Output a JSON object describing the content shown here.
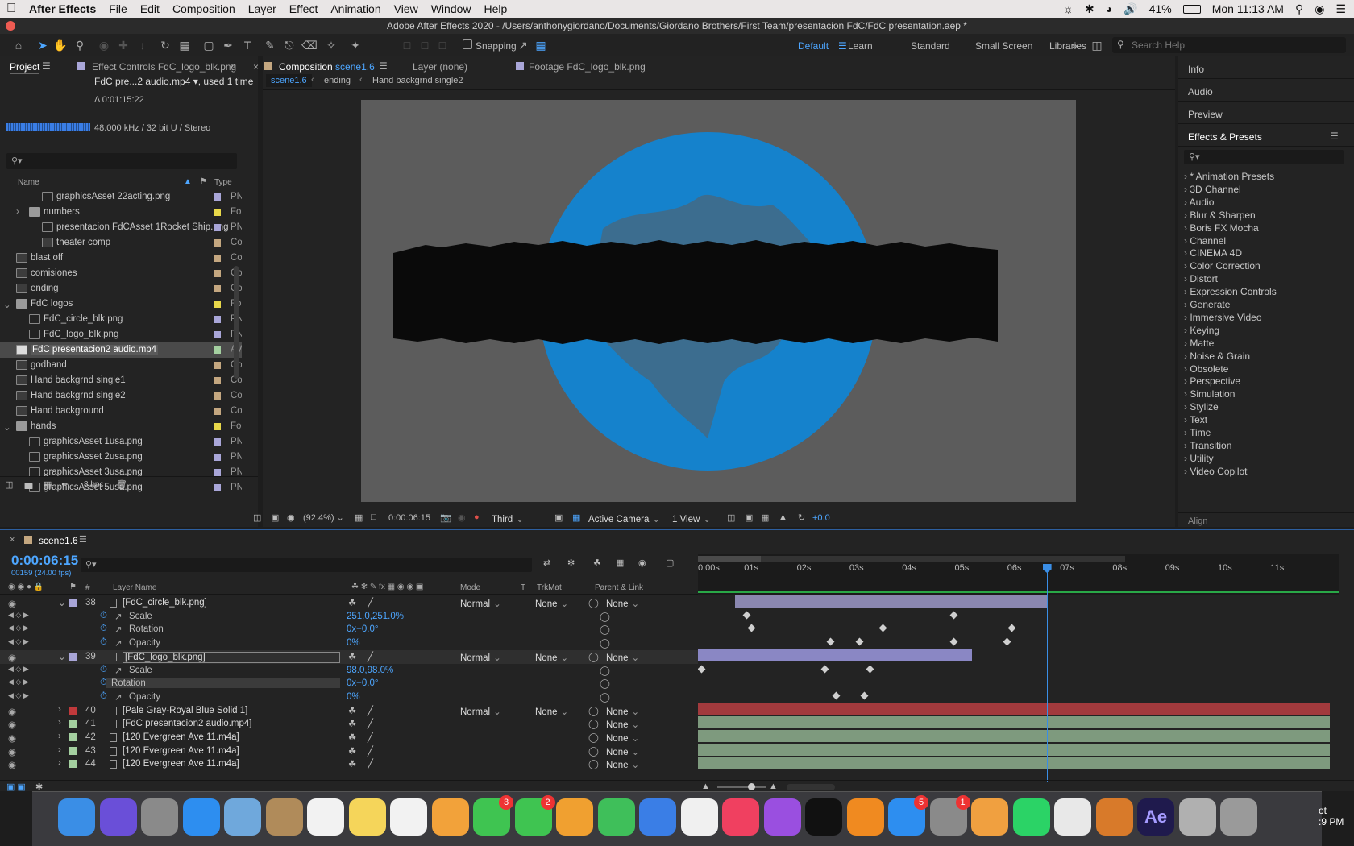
{
  "menubar": {
    "app_name": "After Effects",
    "items": [
      "File",
      "Edit",
      "Composition",
      "Layer",
      "Effect",
      "Animation",
      "View",
      "Window",
      "Help"
    ],
    "battery": "41%",
    "clock": "Mon 11:13 AM"
  },
  "window": {
    "title": "Adobe After Effects 2020 - /Users/anthonygiordano/Documents/Giordano Brothers/First Team/presentacion FdC/FdC presentation.aep *"
  },
  "toolbar": {
    "snapping_label": "Snapping",
    "workspaces": [
      "Default",
      "Learn",
      "Standard",
      "Small Screen",
      "Libraries"
    ],
    "active_workspace": "Default",
    "search_placeholder": "Search Help"
  },
  "project": {
    "tab_project": "Project",
    "tab_effect_controls": "Effect Controls FdC_logo_blk.png",
    "selected_item": "FdC pre...2 audio.mp4 ▾",
    "used_text": ", used 1 time",
    "duration": "Δ 0:01:15:22",
    "audio_info": "48.000 kHz / 32 bit U / Stereo",
    "search_placeholder": "",
    "col_name": "Name",
    "col_type": "Type",
    "items": [
      {
        "name": "graphicsAsset 22acting.png",
        "type": "PN",
        "icon": "png",
        "indent": 2,
        "label": "#a9a6d8"
      },
      {
        "name": "numbers",
        "type": "Fol",
        "icon": "folder",
        "indent": 1,
        "label": "#e8d84a",
        "arrow": "›"
      },
      {
        "name": "presentacion FdCAsset 1Rocket Ship.png",
        "type": "PN",
        "icon": "png",
        "indent": 2,
        "label": "#a9a6d8"
      },
      {
        "name": "theater comp",
        "type": "Cor",
        "icon": "comp",
        "indent": 2,
        "label": "#c4a780"
      },
      {
        "name": "blast off",
        "type": "Cor",
        "icon": "comp",
        "indent": 0,
        "label": "#c4a780"
      },
      {
        "name": "comisiones",
        "type": "Cor",
        "icon": "comp",
        "indent": 0,
        "label": "#c4a780"
      },
      {
        "name": "ending",
        "type": "Cor",
        "icon": "comp",
        "indent": 0,
        "label": "#c4a780"
      },
      {
        "name": "FdC logos",
        "type": "Fol",
        "icon": "folder",
        "indent": 0,
        "label": "#e8d84a",
        "arrow": "⌄"
      },
      {
        "name": "FdC_circle_blk.png",
        "type": "PN",
        "icon": "png",
        "indent": 1,
        "label": "#a9a6d8"
      },
      {
        "name": "FdC_logo_blk.png",
        "type": "PN",
        "icon": "png",
        "indent": 1,
        "label": "#a9a6d8"
      },
      {
        "name": "FdC presentacion2 audio.mp4",
        "type": "AVI",
        "icon": "av",
        "indent": 0,
        "label": "#a4d0a0",
        "selected": true
      },
      {
        "name": "godhand",
        "type": "Cor",
        "icon": "comp",
        "indent": 0,
        "label": "#c4a780"
      },
      {
        "name": "Hand backgrnd single1",
        "type": "Cor",
        "icon": "comp",
        "indent": 0,
        "label": "#c4a780"
      },
      {
        "name": "Hand backgrnd single2",
        "type": "Cor",
        "icon": "comp",
        "indent": 0,
        "label": "#c4a780"
      },
      {
        "name": "Hand background",
        "type": "Cor",
        "icon": "comp",
        "indent": 0,
        "label": "#c4a780"
      },
      {
        "name": "hands",
        "type": "Fol",
        "icon": "folder",
        "indent": 0,
        "label": "#e8d84a",
        "arrow": "⌄"
      },
      {
        "name": "graphicsAsset 1usa.png",
        "type": "PN",
        "icon": "png",
        "indent": 1,
        "label": "#a9a6d8"
      },
      {
        "name": "graphicsAsset 2usa.png",
        "type": "PN",
        "icon": "png",
        "indent": 1,
        "label": "#a9a6d8"
      },
      {
        "name": "graphicsAsset 3usa.png",
        "type": "PN",
        "icon": "png",
        "indent": 1,
        "label": "#a9a6d8"
      },
      {
        "name": "graphicsAsset 5usa.png",
        "type": "PN",
        "icon": "png",
        "indent": 1,
        "label": "#a9a6d8"
      }
    ],
    "bpc": "8 bpc"
  },
  "viewer": {
    "tab_composition_prefix": "Composition",
    "tab_composition_name": "scene1.6",
    "tab_layer": "Layer (none)",
    "tab_footage": "Footage FdC_logo_blk.png",
    "breadcrumbs": [
      "scene1.6",
      "ending",
      "Hand backgrnd single2"
    ],
    "zoom": "(92.4%)",
    "timecode": "0:00:06:15",
    "resolution": "Third",
    "camera": "Active Camera",
    "views": "1 View",
    "exposure": "+0.0"
  },
  "right_panel": {
    "info": "Info",
    "audio": "Audio",
    "preview": "Preview",
    "effects_title": "Effects & Presets",
    "categories": [
      "* Animation Presets",
      "3D Channel",
      "Audio",
      "Blur & Sharpen",
      "Boris FX Mocha",
      "Channel",
      "CINEMA 4D",
      "Color Correction",
      "Distort",
      "Expression Controls",
      "Generate",
      "Immersive Video",
      "Keying",
      "Matte",
      "Noise & Grain",
      "Obsolete",
      "Perspective",
      "Simulation",
      "Stylize",
      "Text",
      "Time",
      "Transition",
      "Utility",
      "Video Copilot"
    ],
    "align": "Align"
  },
  "timeline": {
    "comp_tab": "scene1.6",
    "timecode": "0:00:06:15",
    "frame_info": "00159 (24.00 fps)",
    "col_layer_name": "Layer Name",
    "col_mode": "Mode",
    "col_t": "T",
    "col_trkmat": "TrkMat",
    "col_parent": "Parent & Link",
    "ruler": [
      "0:00s",
      "01s",
      "02s",
      "03s",
      "04s",
      "05s",
      "06s",
      "07s",
      "08s",
      "09s",
      "10s",
      "11s"
    ],
    "playhead_seconds": 6.625,
    "rows": [
      {
        "kind": "layer",
        "num": "38",
        "name": "[FdC_circle_blk.png]",
        "mode": "Normal",
        "trkmat": "None",
        "parent": "None",
        "label": "#a9a6d8",
        "bar": {
          "start": 0.7,
          "end": 6.65,
          "color": "#8a87b0"
        }
      },
      {
        "kind": "prop",
        "name": "Scale",
        "value": "251.0,251.0%",
        "keys": [
          0.85,
          4.8
        ]
      },
      {
        "kind": "prop",
        "name": "Rotation",
        "value": "0x+0.0°",
        "keys": [
          0.95,
          3.45,
          5.9
        ]
      },
      {
        "kind": "prop",
        "name": "Opacity",
        "value": "0%",
        "keys": [
          2.45,
          3.0,
          4.8,
          5.8
        ]
      },
      {
        "kind": "layer",
        "num": "39",
        "name": "[FdC_logo_blk.png]",
        "mode": "Normal",
        "trkmat": "None",
        "parent": "None",
        "label": "#a9a6d8",
        "selected": true,
        "bar": {
          "start": 0.0,
          "end": 5.2,
          "color": "#8a87c4"
        }
      },
      {
        "kind": "prop",
        "name": "Scale",
        "value": "98.0,98.0%",
        "keys": [
          0.0,
          2.35,
          3.2
        ]
      },
      {
        "kind": "prop",
        "name": "Rotation",
        "value": "0x+0.0°",
        "keys": [],
        "highlight": true
      },
      {
        "kind": "prop",
        "name": "Opacity",
        "value": "0%",
        "keys": [
          2.55,
          3.1
        ]
      },
      {
        "kind": "layer",
        "num": "40",
        "name": "[Pale Gray-Royal Blue Solid 1]",
        "mode": "Normal",
        "trkmat": "None",
        "parent": "None",
        "label": "#c0393b",
        "bar": {
          "start": 0.0,
          "end": 12.0,
          "color": "#a23a3d"
        }
      },
      {
        "kind": "layer",
        "num": "41",
        "name": "[FdC presentacion2 audio.mp4]",
        "mode": "",
        "trkmat": "",
        "parent": "None",
        "label": "#a4d0a0",
        "bar": {
          "start": 0.0,
          "end": 12.0,
          "color": "#7e9a7e"
        }
      },
      {
        "kind": "layer",
        "num": "42",
        "name": "[120 Evergreen Ave 11.m4a]",
        "mode": "",
        "trkmat": "",
        "parent": "None",
        "label": "#a4d0a0",
        "bar": {
          "start": 0.0,
          "end": 12.0,
          "color": "#7e9a7e"
        }
      },
      {
        "kind": "layer",
        "num": "43",
        "name": "[120 Evergreen Ave 11.m4a]",
        "mode": "",
        "trkmat": "",
        "parent": "None",
        "label": "#a4d0a0",
        "bar": {
          "start": 0.0,
          "end": 12.0,
          "color": "#7e9a7e"
        }
      },
      {
        "kind": "layer",
        "num": "44",
        "name": "[120 Evergreen Ave 11.m4a]",
        "mode": "",
        "trkmat": "",
        "parent": "None",
        "label": "#a4d0a0",
        "bar": {
          "start": 0.0,
          "end": 12.0,
          "color": "#7e9a7e"
        }
      }
    ]
  },
  "dock": {
    "apps": [
      {
        "name": "finder-icon",
        "color": "#3a8ee6"
      },
      {
        "name": "siri-icon",
        "color": "#6a4fd8"
      },
      {
        "name": "launchpad-icon",
        "color": "#8a8a8a"
      },
      {
        "name": "safari-icon",
        "color": "#2d8ef0"
      },
      {
        "name": "mail-icon",
        "color": "#6fa8dc"
      },
      {
        "name": "contacts-icon",
        "color": "#b08b5a"
      },
      {
        "name": "calendar-icon",
        "color": "#f2f2f2"
      },
      {
        "name": "notes-icon",
        "color": "#f5d55a"
      },
      {
        "name": "reminders-icon",
        "color": "#f2f2f2"
      },
      {
        "name": "photos-icon",
        "color": "#f2a23a"
      },
      {
        "name": "messages-icon",
        "color": "#3fc451",
        "badge": "3"
      },
      {
        "name": "facetime-icon",
        "color": "#3fc451",
        "badge": "2"
      },
      {
        "name": "pages-icon",
        "color": "#f0a030"
      },
      {
        "name": "numbers-icon",
        "color": "#3fbf5a"
      },
      {
        "name": "keynote-icon",
        "color": "#3a7ee6"
      },
      {
        "name": "news-icon",
        "color": "#f0f0f0"
      },
      {
        "name": "music-icon",
        "color": "#f04060"
      },
      {
        "name": "podcasts-icon",
        "color": "#9a4fe0"
      },
      {
        "name": "tv-icon",
        "color": "#111111"
      },
      {
        "name": "books-icon",
        "color": "#f08a20"
      },
      {
        "name": "app-store-icon",
        "color": "#2d8ef0",
        "badge": "5"
      },
      {
        "name": "system-preferences-icon",
        "color": "#8a8a8a",
        "badge": "1"
      },
      {
        "name": "fusion-360-icon",
        "color": "#f0a040"
      },
      {
        "name": "whatsapp-icon",
        "color": "#2bd366"
      },
      {
        "name": "chrome-icon",
        "color": "#e8e8e8"
      },
      {
        "name": "garageband-icon",
        "color": "#d87a2a"
      },
      {
        "name": "after-effects-icon",
        "color": "#1f1a4d"
      },
      {
        "name": "photo-booth-icon",
        "color": "#b0b0b0"
      },
      {
        "name": "trash-icon",
        "color": "#9a9a9a"
      }
    ],
    "ae_label": "Ae",
    "clipped_text": "ot\n:9 PM"
  }
}
